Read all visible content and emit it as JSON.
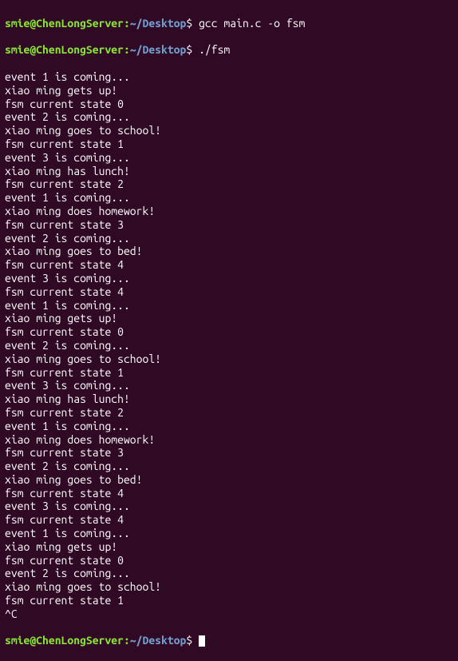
{
  "prompt": {
    "user_host": "smie@ChenLongServer",
    "separator": ":",
    "path": "~/Desktop",
    "symbol": "$"
  },
  "commands": {
    "compile": "gcc main.c -o fsm",
    "run": "./fsm"
  },
  "output_lines": [
    "event 1 is coming...",
    "xiao ming gets up!",
    "fsm current state 0",
    "event 2 is coming...",
    "xiao ming goes to school!",
    "fsm current state 1",
    "event 3 is coming...",
    "xiao ming has lunch!",
    "fsm current state 2",
    "event 1 is coming...",
    "xiao ming does homework!",
    "fsm current state 3",
    "event 2 is coming...",
    "xiao ming goes to bed!",
    "fsm current state 4",
    "event 3 is coming...",
    "fsm current state 4",
    "event 1 is coming...",
    "xiao ming gets up!",
    "fsm current state 0",
    "event 2 is coming...",
    "xiao ming goes to school!",
    "fsm current state 1",
    "event 3 is coming...",
    "xiao ming has lunch!",
    "fsm current state 2",
    "event 1 is coming...",
    "xiao ming does homework!",
    "fsm current state 3",
    "event 2 is coming...",
    "xiao ming goes to bed!",
    "fsm current state 4",
    "event 3 is coming...",
    "fsm current state 4",
    "event 1 is coming...",
    "xiao ming gets up!",
    "fsm current state 0",
    "event 2 is coming...",
    "xiao ming goes to school!",
    "fsm current state 1",
    "^C"
  ]
}
